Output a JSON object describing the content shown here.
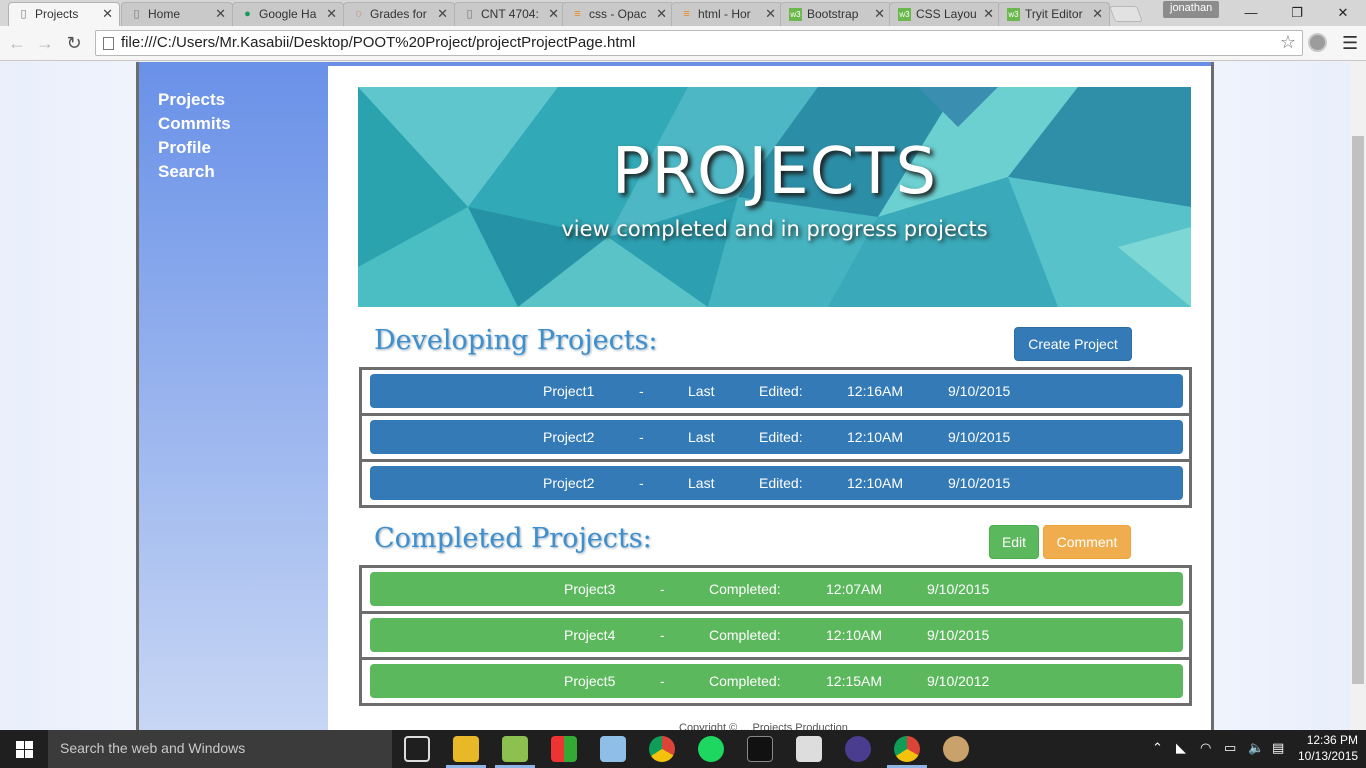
{
  "browser": {
    "tabs": [
      {
        "title": "Projects",
        "active": true
      },
      {
        "title": "Home",
        "active": false
      },
      {
        "title": "Google Ha",
        "active": false
      },
      {
        "title": "Grades for",
        "active": false
      },
      {
        "title": "CNT 4704:",
        "active": false
      },
      {
        "title": "css - Opac",
        "active": false
      },
      {
        "title": "html - Hor",
        "active": false
      },
      {
        "title": "Bootstrap",
        "active": false
      },
      {
        "title": "CSS Layou",
        "active": false
      },
      {
        "title": "Tryit Editor",
        "active": false
      }
    ],
    "profile_name": "jonathan",
    "url": "file:///C:/Users/Mr.Kasabii/Desktop/POOT%20Project/projectProjectPage.html"
  },
  "sidebar": {
    "items": [
      {
        "label": "Projects"
      },
      {
        "label": "Commits"
      },
      {
        "label": "Profile"
      },
      {
        "label": "Search"
      }
    ]
  },
  "hero": {
    "title": "PROJECTS",
    "subtitle": "view completed and in progress projects"
  },
  "developing": {
    "heading": "Developing Projects:",
    "create_label": "Create Project",
    "rows": [
      {
        "name": "Project1",
        "sep": "-",
        "word1": "Last",
        "word2": "Edited:",
        "time": "12:16AM",
        "date": "9/10/2015"
      },
      {
        "name": "Project2",
        "sep": "-",
        "word1": "Last",
        "word2": "Edited:",
        "time": "12:10AM",
        "date": "9/10/2015"
      },
      {
        "name": "Project2",
        "sep": "-",
        "word1": "Last",
        "word2": "Edited:",
        "time": "12:10AM",
        "date": "9/10/2015"
      }
    ]
  },
  "completed": {
    "heading": "Completed Projects:",
    "edit_label": "Edit",
    "comment_label": "Comment",
    "rows": [
      {
        "name": "Project3",
        "sep": "-",
        "status": "Completed:",
        "time": "12:07AM",
        "date": "9/10/2015"
      },
      {
        "name": "Project4",
        "sep": "-",
        "status": "Completed:",
        "time": "12:10AM",
        "date": "9/10/2015"
      },
      {
        "name": "Project5",
        "sep": "-",
        "status": "Completed:",
        "time": "12:15AM",
        "date": "9/10/2012"
      }
    ]
  },
  "footer": {
    "text": "Copyright © ... Projects Production"
  },
  "taskbar": {
    "search_placeholder": "Search the web and Windows",
    "time": "12:36 PM",
    "date": "10/13/2015"
  },
  "colors": {
    "developing_bar": "#337ab7",
    "completed_bar": "#5cb85c",
    "comment_button": "#f0ad4e",
    "section_heading": "#3d8fcd",
    "sidebar_top": "#6991e8"
  }
}
